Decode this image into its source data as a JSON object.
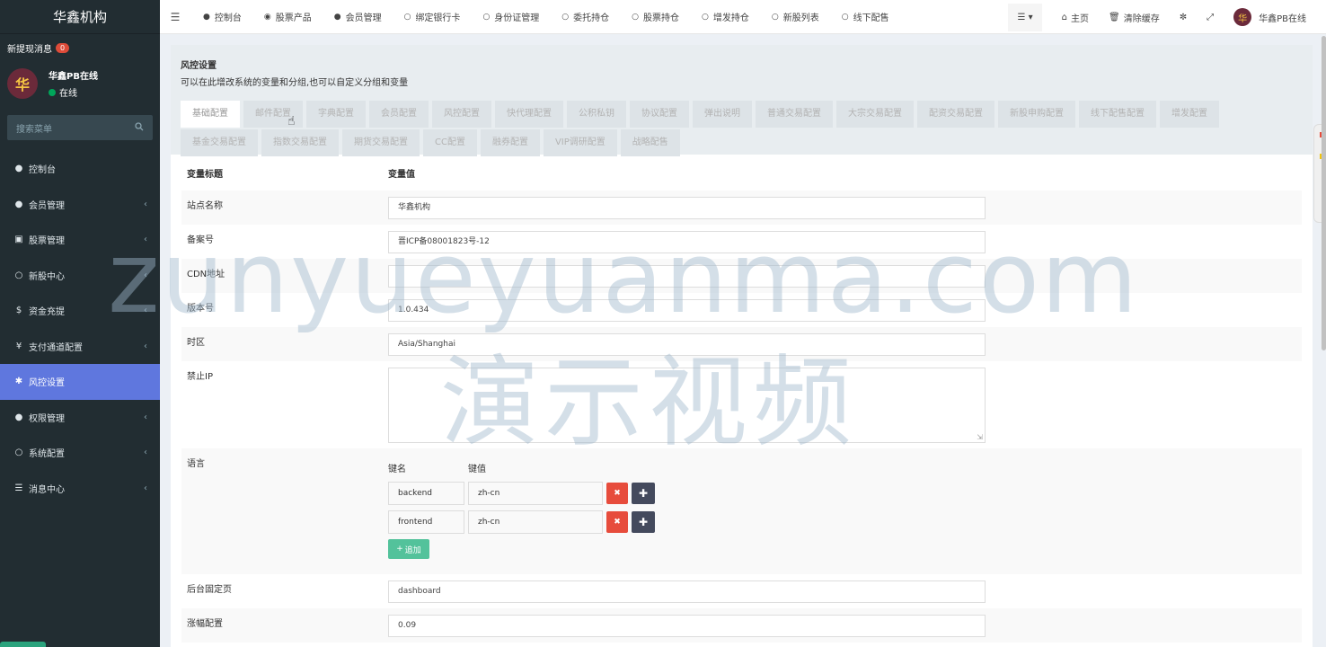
{
  "sidebar": {
    "brand": "华鑫机构",
    "new_msg_label": "新提现消息",
    "new_msg_count": "0",
    "user_name": "华鑫PB在线",
    "user_status": "在线",
    "avatar_char": "华",
    "search_placeholder": "搜索菜单",
    "items": [
      {
        "label": "控制台",
        "icon": "dashboard-icon",
        "caret": false
      },
      {
        "label": "会员管理",
        "icon": "user-icon",
        "caret": true
      },
      {
        "label": "股票管理",
        "icon": "bank-icon",
        "caret": true
      },
      {
        "label": "新股中心",
        "icon": "circle-icon",
        "caret": true
      },
      {
        "label": "资金充提",
        "icon": "dollar-icon",
        "caret": true
      },
      {
        "label": "支付通道配置",
        "icon": "yen-icon",
        "caret": true
      },
      {
        "label": "风控设置",
        "icon": "gear-icon",
        "caret": false,
        "active": true
      },
      {
        "label": "权限管理",
        "icon": "group-icon",
        "caret": true
      },
      {
        "label": "系统配置",
        "icon": "circle-icon",
        "caret": true
      },
      {
        "label": "消息中心",
        "icon": "list-icon",
        "caret": true
      }
    ]
  },
  "navbar": {
    "items": [
      "控制台",
      "股票产品",
      "会员管理",
      "绑定银行卡",
      "身份证管理",
      "委托持仓",
      "股票持仓",
      "增发持仓",
      "新股列表",
      "线下配售"
    ],
    "home": "主页",
    "clear_cache": "清除缓存",
    "user": "华鑫PB在线"
  },
  "panel": {
    "title": "风控设置",
    "description": "可以在此增改系统的变量和分组,也可以自定义分组和变量",
    "tabs": [
      "基础配置",
      "邮件配置",
      "字典配置",
      "会员配置",
      "风控配置",
      "快代理配置",
      "公积私钥",
      "协议配置",
      "弹出说明",
      "普通交易配置",
      "大宗交易配置",
      "配资交易配置",
      "新股申购配置",
      "线下配售配置",
      "增发配置",
      "基金交易配置",
      "指数交易配置",
      "期货交易配置",
      "CC配置",
      "融券配置",
      "VIP调研配置",
      "战略配售"
    ],
    "active_tab": 0
  },
  "form": {
    "header_title": "变量标题",
    "header_value": "变量值",
    "site_name_label": "站点名称",
    "site_name": "华鑫机构",
    "beian_label": "备案号",
    "beian": "晋ICP备08001823号-12",
    "cdn_label": "CDN地址",
    "cdn": "",
    "version_label": "版本号",
    "version": "1.0.434",
    "timezone_label": "时区",
    "timezone": "Asia/Shanghai",
    "ban_ip_label": "禁止IP",
    "ban_ip": "",
    "lang_label": "语言",
    "kv_key_header": "键名",
    "kv_value_header": "键值",
    "lang_rows": [
      {
        "key": "backend",
        "value": "zh-cn"
      },
      {
        "key": "frontend",
        "value": "zh-cn"
      }
    ],
    "add_label": "追加",
    "fixed_page_label": "后台固定页",
    "fixed_page": "dashboard",
    "rise_label": "涨幅配置",
    "rise": "0.09"
  },
  "watermark": {
    "line1": "zunyueyuanma.com",
    "line2": "演示视频"
  }
}
